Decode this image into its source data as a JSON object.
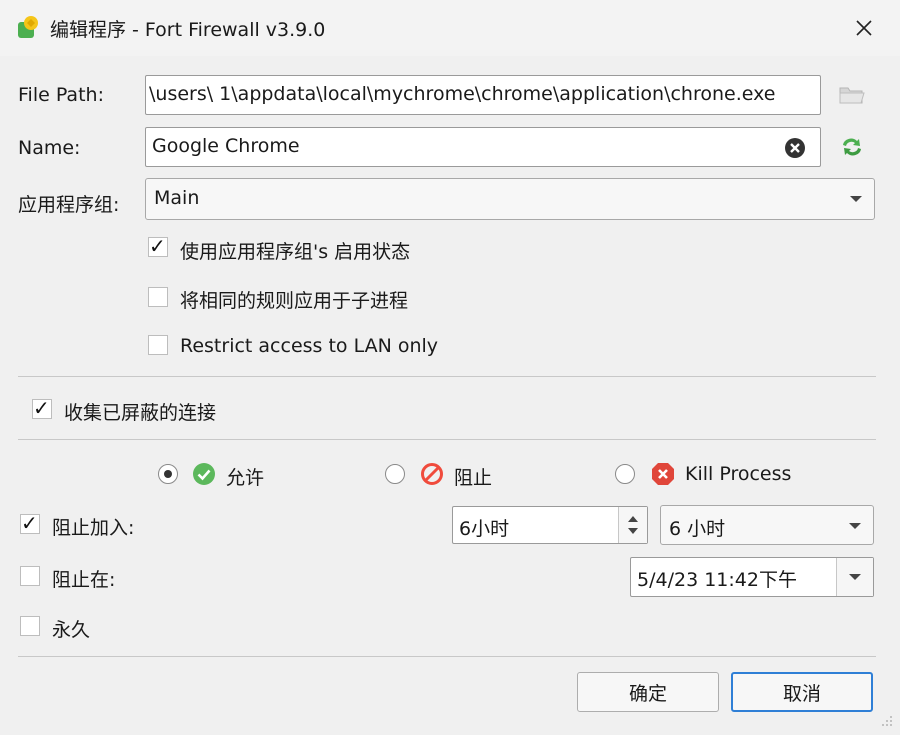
{
  "window": {
    "title": "编辑程序 - Fort Firewall v3.9.0"
  },
  "form": {
    "file_path_label": "File Path:",
    "file_path_value": "\\users\\          1\\appdata\\local\\mychrome\\chrome\\application\\chrone.exe",
    "name_label": "Name:",
    "name_value": "Google Chrome",
    "group_label": "应用程序组:",
    "group_value": "Main"
  },
  "options": {
    "use_group_state": {
      "label": "使用应用程序组's 启用状态",
      "checked": true
    },
    "apply_child": {
      "label": "将相同的规则应用于子进程",
      "checked": false
    },
    "lan_only": {
      "label": "Restrict access to LAN only",
      "checked": false
    },
    "collect_blocked": {
      "label": "收集已屏蔽的连接",
      "checked": true
    }
  },
  "action": {
    "allow_label": "允许",
    "block_label": "阻止",
    "kill_label": "Kill Process",
    "selected": "allow"
  },
  "schedule": {
    "block_in_label": "阻止加入:",
    "block_in_checked": true,
    "block_in_spin_value": "6小时",
    "block_in_combo_value": "6 小时",
    "block_at_label": "阻止在:",
    "block_at_checked": false,
    "block_at_value": "5/4/23 11:42下午",
    "forever_label": "永久",
    "forever_checked": false
  },
  "buttons": {
    "ok": "确定",
    "cancel": "取消"
  },
  "colors": {
    "allow_green": "#5cb85c",
    "block_red": "#f04b3c",
    "kill_red": "#e0463a",
    "default_button_border": "#2f7fd6"
  }
}
